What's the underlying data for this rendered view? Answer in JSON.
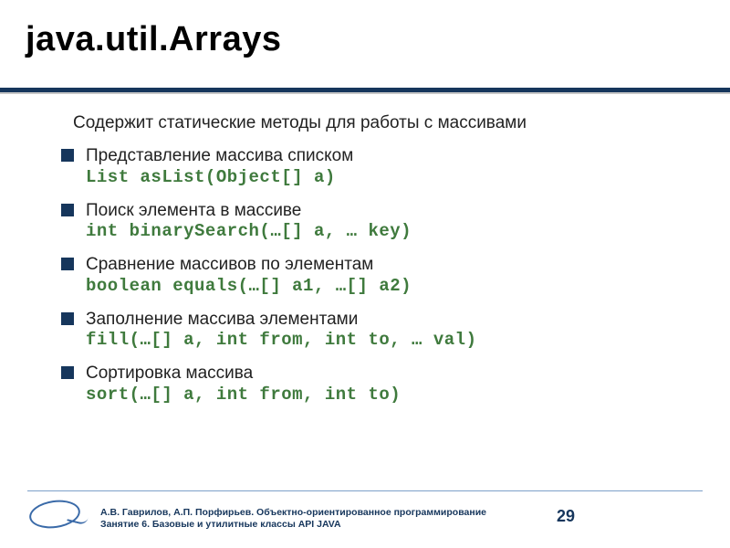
{
  "title": "java.util.Arrays",
  "intro": "Содержит статические методы для работы с массивами",
  "items": [
    {
      "desc": "Представление массива списком",
      "code": "List asList(Object[] a)"
    },
    {
      "desc": "Поиск элемента в массиве",
      "code": "int binarySearch(…[] a, … key)"
    },
    {
      "desc": "Сравнение массивов по элементам",
      "code": "boolean equals(…[] a1, …[] a2)"
    },
    {
      "desc": "Заполнение массива элементами",
      "code": "fill(…[] a, int from, int to, … val)"
    },
    {
      "desc": "Сортировка массива",
      "code": "sort(…[] a, int from, int to)"
    }
  ],
  "footer": {
    "line1": "А.В. Гаврилов, А.П. Порфирьев. Объектно-ориентированное программирование",
    "line2": "Занятие 6. Базовые и утилитные классы API JAVA"
  },
  "page_number": "29"
}
